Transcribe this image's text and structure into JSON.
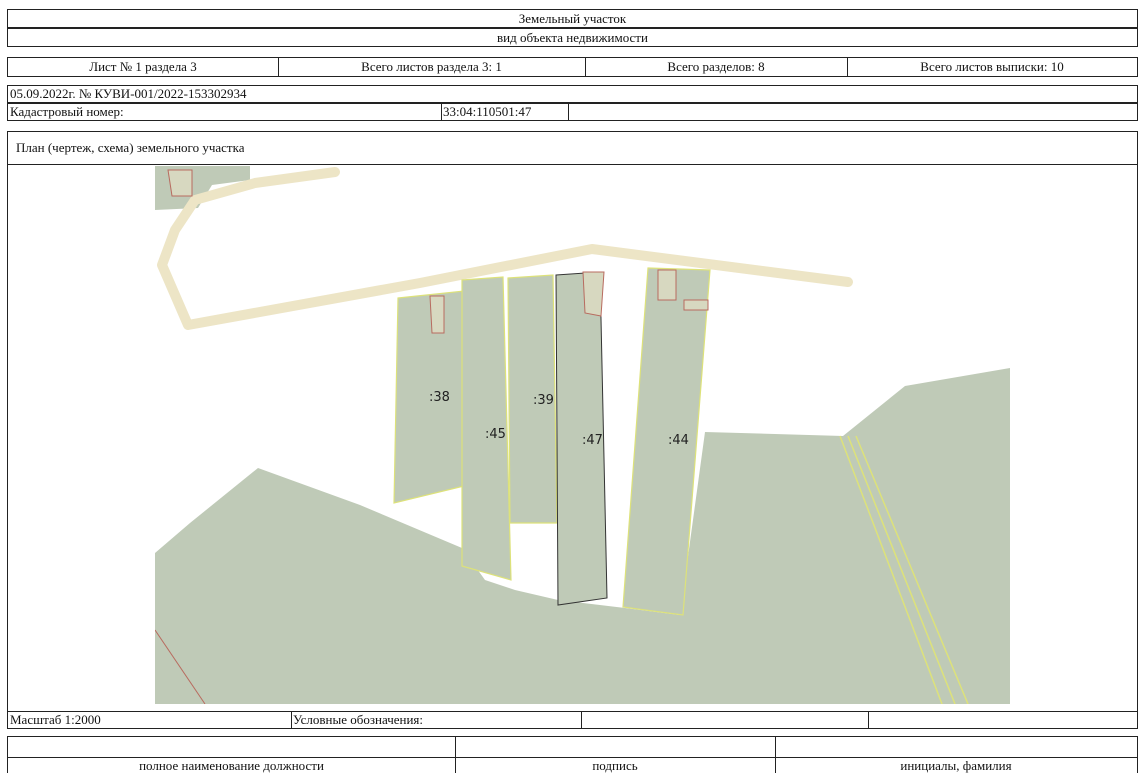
{
  "header": {
    "title": "Земельный участок",
    "subtitle": "вид объекта недвижимости"
  },
  "sheet_info": {
    "sheet": "Лист № 1 раздела 3",
    "total_sheets_section": "Всего листов раздела 3: 1",
    "total_sections": "Всего разделов: 8",
    "total_sheets_extract": "Всего листов выписки: 10"
  },
  "doc": {
    "date_number": "05.09.2022г. № КУВИ-001/2022-153302934",
    "cadastral_label": "Кадастровый номер:",
    "cadastral_value": "33:04:110501:47"
  },
  "plan": {
    "title": "План (чертеж, схема) земельного участка",
    "parcels": [
      {
        "label": ":38"
      },
      {
        "label": ":45"
      },
      {
        "label": ":39"
      },
      {
        "label": ":47"
      },
      {
        "label": ":44"
      }
    ],
    "colors": {
      "parcel_fill": "#bfcab7",
      "road": "#ede5c6",
      "parcel_border": "#dde27a",
      "selected_border": "#333333",
      "building": "#b86b5f"
    }
  },
  "legend": {
    "scale": "Масштаб 1:2000",
    "conventions": "Условные обозначения:"
  },
  "signature": {
    "position_caption": "полное наименование должности",
    "signature_caption": "подпись",
    "name_caption": "инициалы, фамилия"
  }
}
